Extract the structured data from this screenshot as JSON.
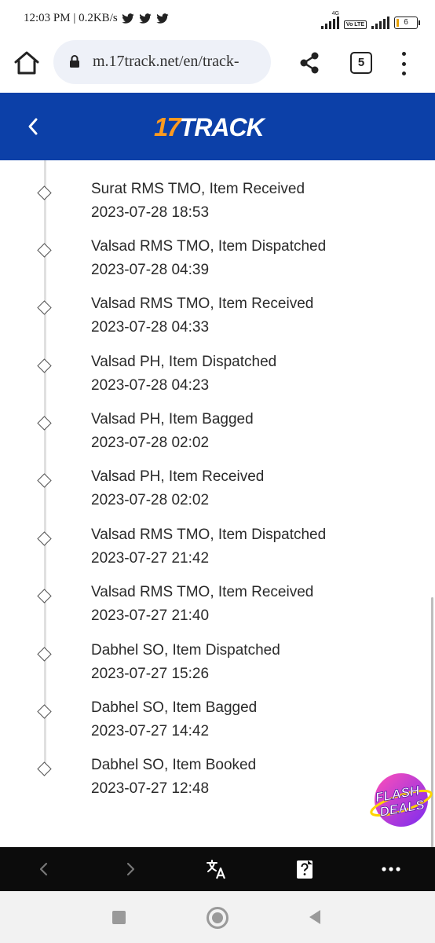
{
  "status_bar": {
    "time_speed": "12:03 PM | 0.2KB/s",
    "network": "4G",
    "volte": "Vo LTE",
    "battery": "6"
  },
  "browser": {
    "url": "m.17track.net/en/track-",
    "tab_count": "5"
  },
  "header": {
    "logo_number": "17",
    "logo_text": "TRACK"
  },
  "events": [
    {
      "desc": "Surat RMS TMO, Item Received",
      "time": "2023-07-28 18:53"
    },
    {
      "desc": "Valsad RMS TMO, Item Dispatched",
      "time": "2023-07-28 04:39"
    },
    {
      "desc": "Valsad RMS TMO, Item Received",
      "time": "2023-07-28 04:33"
    },
    {
      "desc": "Valsad PH, Item Dispatched",
      "time": "2023-07-28 04:23"
    },
    {
      "desc": "Valsad PH, Item Bagged",
      "time": "2023-07-28 02:02"
    },
    {
      "desc": "Valsad PH, Item Received",
      "time": "2023-07-28 02:02"
    },
    {
      "desc": "Valsad RMS TMO, Item Dispatched",
      "time": "2023-07-27 21:42"
    },
    {
      "desc": "Valsad RMS TMO, Item Received",
      "time": "2023-07-27 21:40"
    },
    {
      "desc": "Dabhel SO, Item Dispatched",
      "time": "2023-07-27 15:26"
    },
    {
      "desc": "Dabhel SO, Item Bagged",
      "time": "2023-07-27 14:42"
    },
    {
      "desc": "Dabhel SO, Item Booked",
      "time": "2023-07-27 12:48"
    }
  ],
  "flash_deals": {
    "line1": "FLASH",
    "line2": "DEALS"
  },
  "colors": {
    "header_bg": "#0c40a8",
    "logo_accent": "#ff9a1f",
    "toolbar_bg": "#0c0c0c"
  }
}
